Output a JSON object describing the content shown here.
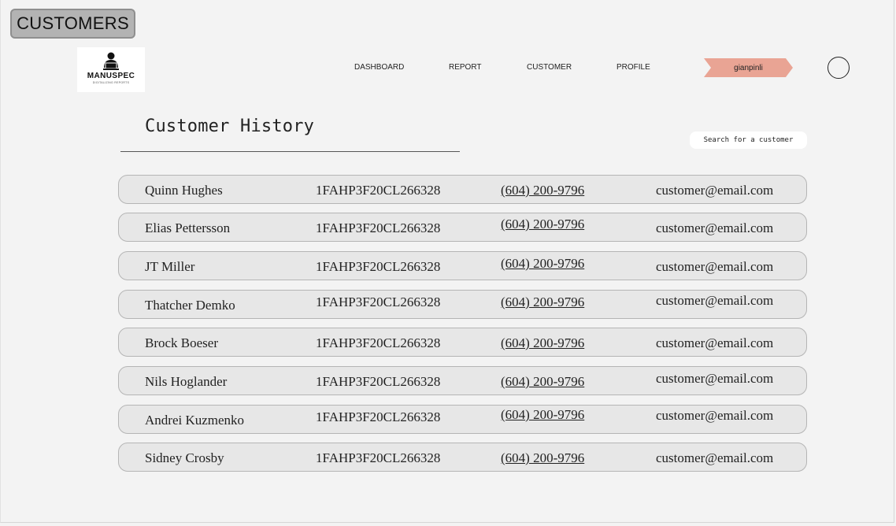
{
  "page_tag": "CUSTOMERS",
  "brand": {
    "name": "MANUSPEC",
    "tagline": "DIGITALIZING REPORTS"
  },
  "nav": {
    "dashboard": "DASHBOARD",
    "report": "REPORT",
    "customer": "CUSTOMER",
    "profile": "PROFILE",
    "user": "gianpinli"
  },
  "title": "Customer History",
  "search": {
    "placeholder": "Search for a customer"
  },
  "customers": [
    {
      "name": "Quinn Hughes",
      "vin": "1FAHP3F20CL266328",
      "phone": "(604) 200-9796",
      "email": "customer@email.com"
    },
    {
      "name": "Elias Pettersson",
      "vin": "1FAHP3F20CL266328",
      "phone": "(604) 200-9796",
      "email": "customer@email.com"
    },
    {
      "name": "JT Miller",
      "vin": "1FAHP3F20CL266328",
      "phone": "(604) 200-9796",
      "email": "customer@email.com"
    },
    {
      "name": "Thatcher Demko",
      "vin": "1FAHP3F20CL266328",
      "phone": "(604) 200-9796",
      "email": "customer@email.com"
    },
    {
      "name": "Brock Boeser",
      "vin": "1FAHP3F20CL266328",
      "phone": "(604) 200-9796",
      "email": "customer@email.com"
    },
    {
      "name": "Nils Hoglander",
      "vin": "1FAHP3F20CL266328",
      "phone": "(604) 200-9796",
      "email": "customer@email.com"
    },
    {
      "name": "Andrei Kuzmenko",
      "vin": "1FAHP3F20CL266328",
      "phone": "(604) 200-9796",
      "email": "customer@email.com"
    },
    {
      "name": "Sidney Crosby",
      "vin": "1FAHP3F20CL266328",
      "phone": "(604) 200-9796",
      "email": "customer@email.com"
    }
  ]
}
